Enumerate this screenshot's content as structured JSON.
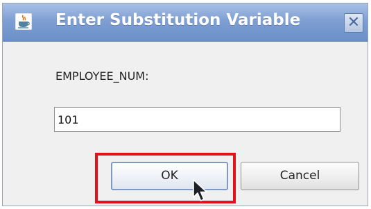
{
  "dialog": {
    "title": "Enter Substitution Variable",
    "close_glyph": "✕",
    "app_icon": "java-coffee-cup-icon"
  },
  "form": {
    "label": "EMPLOYEE_NUM:",
    "value": "101"
  },
  "buttons": {
    "ok_label": "OK",
    "cancel_label": "Cancel"
  },
  "annotation": {
    "highlight_color": "#e0121c"
  },
  "colors": {
    "titlebar": "#7e9fd3",
    "dialog_bg": "#f0f0f0"
  }
}
